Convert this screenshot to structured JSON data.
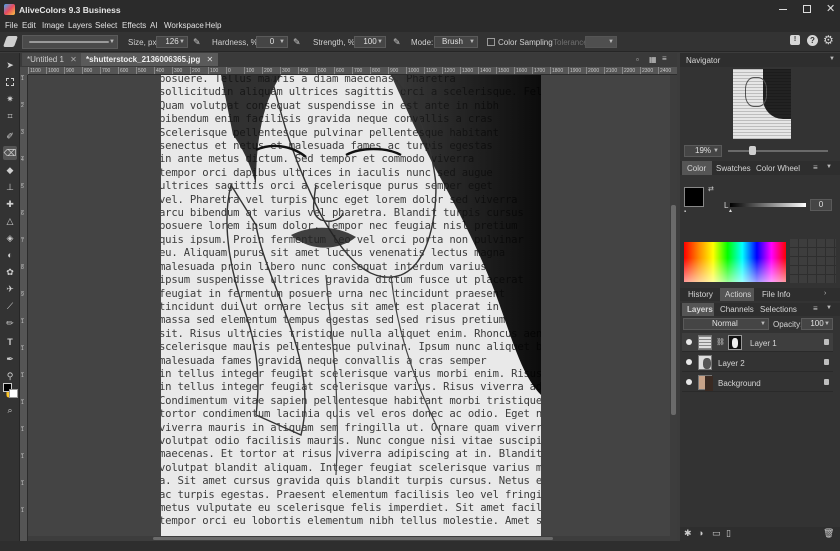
{
  "app": {
    "title": "AliveColors 9.3 Business"
  },
  "menu": [
    "File",
    "Edit",
    "Image",
    "Layers",
    "Select",
    "Effects",
    "AI",
    "Workspace",
    "Help"
  ],
  "options": {
    "size_label": "Size, px",
    "size_value": "126",
    "hardness_label": "Hardness, %",
    "hardness_value": "0",
    "strength_label": "Strength, %",
    "strength_value": "100",
    "mode_label": "Mode:",
    "mode_value": "Brush",
    "color_sampling": "Color Sampling",
    "tolerance_label": "Tolerance"
  },
  "tabs": [
    {
      "label": "*Untitled 1"
    },
    {
      "label": "*shutterstock_2136006365.jpg"
    }
  ],
  "ruler_top": [
    "1100",
    "1000",
    "900",
    "800",
    "700",
    "600",
    "500",
    "400",
    "300",
    "200",
    "100",
    "0",
    "100",
    "200",
    "300",
    "400",
    "500",
    "600",
    "700",
    "800",
    "900",
    "1000",
    "1100",
    "1200",
    "1300",
    "1400",
    "1500",
    "1600",
    "1700",
    "1800",
    "1900",
    "2000",
    "2100",
    "2200",
    "2300",
    "2400"
  ],
  "ruler_left": [
    "1",
    "2",
    "3",
    "4",
    "5",
    "6",
    "7",
    "8",
    "9",
    "1",
    "1",
    "1",
    "1",
    "1",
    "1",
    "1",
    "1"
  ],
  "doc_text": [
    "posuere. Tellus mauris a diam maecenas. Pharetra",
    "sollicitudin aliquam ultrices sagittis orci a scelerisque. Fels",
    "Quam volutpat consequat suspendisse in est ante in nibh",
    "bibendum enim facilisis gravida neque convallis a cras",
    "Scelerisque pellentesque pulvinar pellentesque habitant",
    "senectus et netus et malesuada fames ac turpis egestas",
    "in ante metus dictum. Sed tempor et commodo viverra",
    "tempor orci dapibus ultrices in iaculis nunc sed augue",
    "ultrices sagittis orci a scelerisque purus semper eget",
    "vel. Pharetra vel turpis nunc eget lorem dolor sed viverra",
    "arcu bibendum at varius vel pharetra. Blandit turpis cursus",
    "posuere lorem ipsum dolor. Tempor nec feugiat nisl pretium",
    "quis ipsum. Proin fermentum leo vel orci porta non pulvinar",
    "eu. Aliquam purus sit amet luctus venenatis lectus magna",
    "malesuada proin libero nunc consequat interdum varius",
    "ipsum suspendisse ultrices gravida dictum fusce ut placerat",
    "feugiat in fermentum posuere urna nec tincidunt praesent",
    "tincidunt dui ut ornare lectus sit amet est placerat in",
    "massa sed elementum tempus egestas sed sed risus pretium",
    "sit. Risus ultricies tristique nulla aliquet enim. Rhoncus aenean",
    "scelerisque mauris pellentesque pulvinar. Ipsum nunc aliquet bibendum",
    "malesuada fames gravida neque convallis a cras semper",
    "in tellus integer feugiat scelerisque varius morbi enim. Risus viverra adipiscing at",
    "in tellus integer feugiat scelerisque varius. Risus viverra adipiscing at",
    "Condimentum vitae sapien pellentesque habitant morbi tristique senectus et. Vitae",
    "tortor condimentum lacinia quis vel eros donec ac odio. Eget nunc scelerisque",
    "viverra mauris in aliquam sem fringilla ut. Ornare quam viverra orci sagittis eu",
    "volutpat odio facilisis mauris. Nunc congue nisi vitae suscipit tellus mauris a diam",
    "maecenas. Et tortor at risus viverra adipiscing at in. Blandit volutpat maecenas",
    "volutpat blandit aliquam. Integer feugiat scelerisque varius morbi enim nunc faucibus",
    "a. Sit amet cursus gravida quis blandit turpis cursus. Netus et malesuada fames",
    "ac turpis egestas. Praesent elementum facilisis leo vel fringilla est ullamcorper. Tellus in",
    "metus vulputate eu scelerisque felis imperdiet. Sit amet facilisis magna etiam",
    "tempor orci eu lobortis elementum nibh tellus molestie. Amet scelerisque varius"
  ],
  "navigator": {
    "title": "Navigator",
    "zoom": "19%"
  },
  "color_panel": {
    "tabs": [
      "Color",
      "Swatches",
      "Color Wheel"
    ],
    "l_label": "L",
    "l_value": "0"
  },
  "history_panel": {
    "tabs": [
      "History",
      "Actions",
      "File Info"
    ]
  },
  "layers_panel": {
    "tabs": [
      "Layers",
      "Channels",
      "Selections"
    ],
    "blend_mode": "Normal",
    "opacity_label": "Opacity:",
    "opacity_value": "100",
    "layers": [
      {
        "name": "Layer 1"
      },
      {
        "name": "Layer 2"
      },
      {
        "name": "Background"
      }
    ]
  },
  "colors": {
    "accent": "#6a6a6a",
    "active_tab": "#5a5a5a"
  }
}
